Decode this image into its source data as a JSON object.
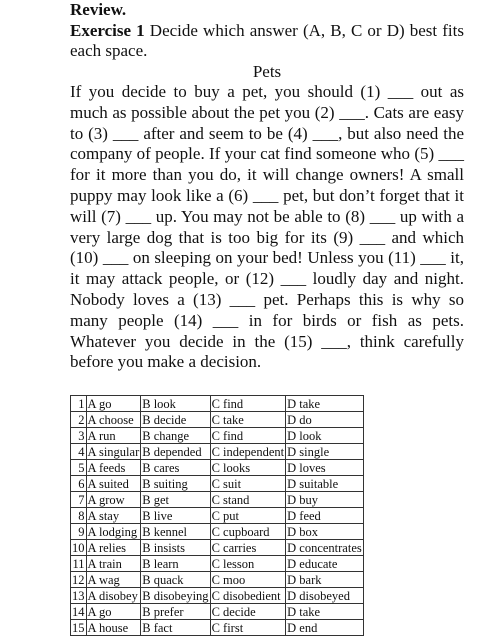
{
  "heading": "Review.",
  "exercise": {
    "label": "Exercise 1",
    "instruction": " Decide which answer (A, B, C or D) best fits each space."
  },
  "passage": {
    "title": "Pets",
    "text": "If you decide to buy a pet, you should (1) ___ out as much as possible about the pet you (2) ___. Cats are easy to (3) ___ after and seem to be (4) ___, but also need the company of people. If your cat find someone who (5) ___ for it more than you do, it will change owners! A small puppy may look like a (6) ___ pet, but don’t forget that it will (7) ___ up. You may not be able to (8) ___ up with a very large dog that is too big for its (9) ___ and which (10) ___ on sleeping on your bed! Unless you (11) ___ it, it may attack people, or (12) ___ loudly day and night. Nobody loves a (13) ___ pet. Perhaps this is why so many people (14) ___ in for birds or fish as pets. Whatever you decide in the (15) ___, think carefully before you make a decision."
  },
  "answers": [
    {
      "num": "1",
      "a": "A go",
      "b": "B look",
      "c": "C find",
      "d": "D take"
    },
    {
      "num": "2",
      "a": "A choose",
      "b": "B decide",
      "c": "C take",
      "d": "D do"
    },
    {
      "num": "3",
      "a": "A run",
      "b": "B change",
      "c": "C find",
      "d": "D look"
    },
    {
      "num": "4",
      "a": "A singular",
      "b": "B depended",
      "c": "C independent",
      "d": "D single"
    },
    {
      "num": "5",
      "a": "A feeds",
      "b": "B cares",
      "c": "C looks",
      "d": "D loves"
    },
    {
      "num": "6",
      "a": "A suited",
      "b": "B suiting",
      "c": "C suit",
      "d": "D suitable"
    },
    {
      "num": "7",
      "a": "A grow",
      "b": "B get",
      "c": "C stand",
      "d": "D buy"
    },
    {
      "num": "8",
      "a": "A stay",
      "b": "B live",
      "c": "C put",
      "d": "D feed"
    },
    {
      "num": "9",
      "a": "A lodging",
      "b": "B kennel",
      "c": "C cupboard",
      "d": "D box"
    },
    {
      "num": "10",
      "a": "A relies",
      "b": "B insists",
      "c": "C carries",
      "d": "D concentrates"
    },
    {
      "num": "11",
      "a": "A train",
      "b": "B learn",
      "c": "C lesson",
      "d": "D educate"
    },
    {
      "num": "12",
      "a": "A wag",
      "b": "B quack",
      "c": "C moo",
      "d": "D bark"
    },
    {
      "num": "13",
      "a": "A disobey",
      "b": "B disobeying",
      "c": "C disobedient",
      "d": "D disobeyed"
    },
    {
      "num": "14",
      "a": "A go",
      "b": "B prefer",
      "c": "C decide",
      "d": "D take"
    },
    {
      "num": "15",
      "a": "A house",
      "b": "B fact",
      "c": "C first",
      "d": "D end"
    }
  ]
}
